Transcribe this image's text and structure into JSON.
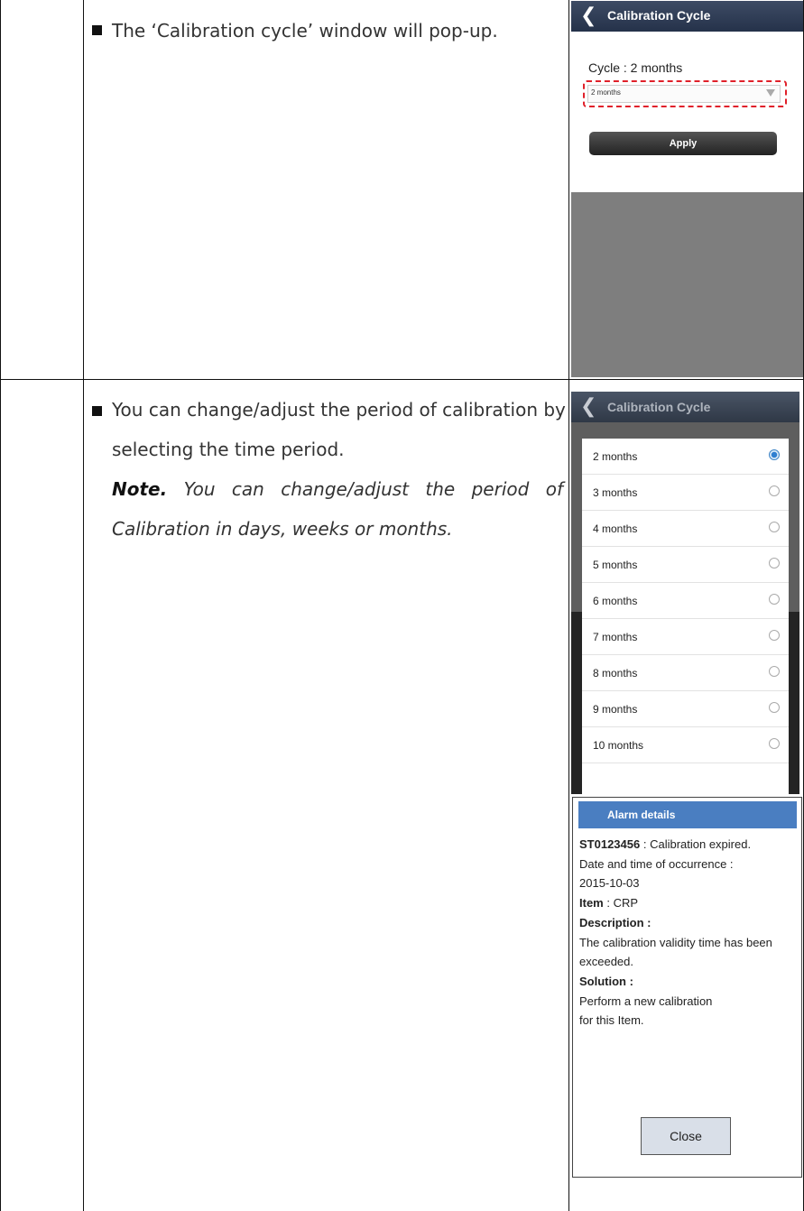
{
  "step1": {
    "text": "The ‘Calibration cycle’ window will pop-up."
  },
  "step2": {
    "text_line1": "You can change/adjust the period of calibration by",
    "text_line2": "selecting the time period.",
    "note_label": "Note.",
    "note_text": " You can change/adjust the period of Calibration in days, weeks or months."
  },
  "screen1": {
    "back_icon": "chevron-left-icon",
    "title": "Calibration Cycle",
    "cycle_label": "Cycle : 2 months",
    "dropdown_value": "2 months",
    "apply_label": "Apply",
    "highlight_color": "#e0202a"
  },
  "screen2": {
    "title": "Calibration Cycle",
    "options": [
      "2 months",
      "3 months",
      "4 months",
      "5 months",
      "6 months",
      "7 months",
      "8 months",
      "9 months",
      "10 months"
    ],
    "selected": "2 months",
    "accent_color": "#2f7fd0"
  },
  "alarm": {
    "header": "Alarm details",
    "code": "ST0123456",
    "code_msg": " : Calibration expired.",
    "date_label": "Date and time of occurrence :",
    "date_value": "2015-10-03",
    "item_label": "Item",
    "item_value": " : CRP",
    "desc_label": "Description :",
    "desc_text": "The calibration validity time has been exceeded.",
    "sol_label": "Solution :",
    "sol_text_1": "Perform a new calibration",
    "sol_text_2": "for this Item.",
    "close_label": "Close",
    "header_color": "#4a7ec1"
  }
}
